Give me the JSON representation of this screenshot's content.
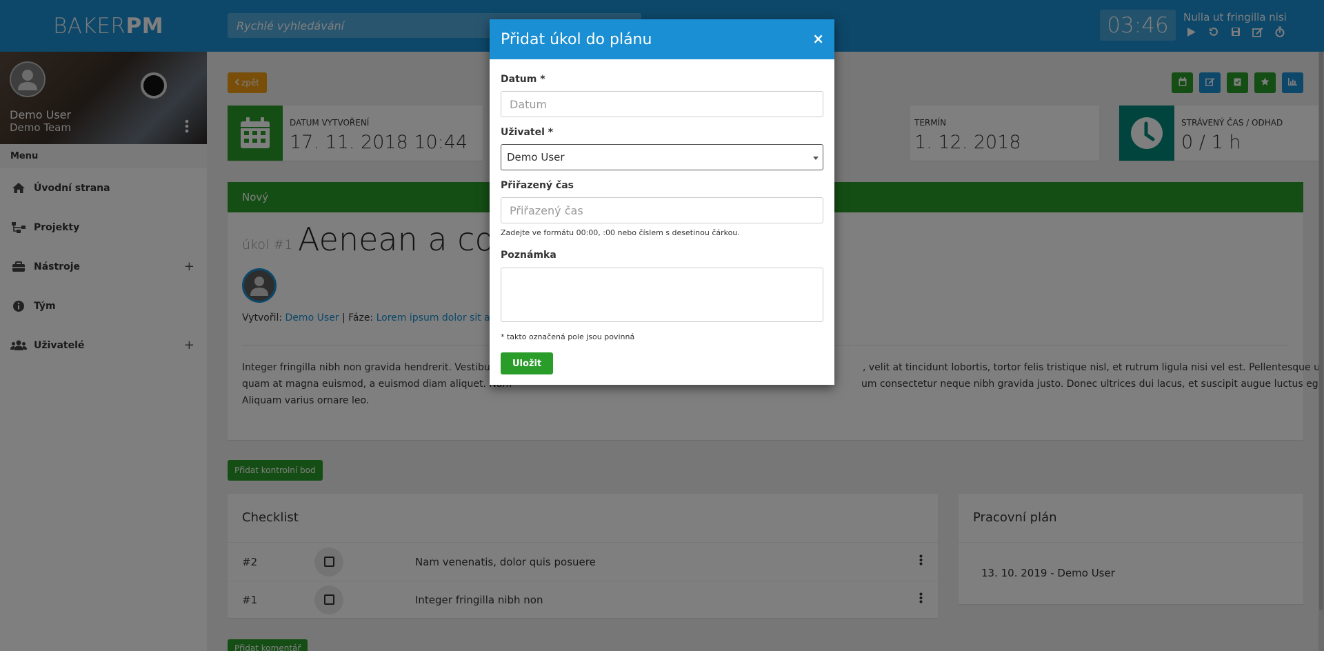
{
  "header": {
    "logo_light": "BAKER",
    "logo_bold": "PM",
    "search_placeholder": "Rychlé vyhledávání",
    "timer": "03:46",
    "timer_task": "Nulla ut fringilla nisi"
  },
  "sidebar": {
    "user_name": "Demo User",
    "user_team": "Demo Team",
    "menu_header": "Menu",
    "items": [
      {
        "label": "Úvodní strana",
        "icon": "home-icon"
      },
      {
        "label": "Projekty",
        "icon": "sitemap-icon"
      },
      {
        "label": "Nástroje",
        "icon": "toolbox-icon",
        "plus": "+"
      },
      {
        "label": "Tým",
        "icon": "info-icon"
      },
      {
        "label": "Uživatelé",
        "icon": "users-icon",
        "plus": "+"
      }
    ]
  },
  "main": {
    "back_label": "zpět",
    "info": {
      "created_label": "Datum vytvoření",
      "created_value": "17. 11. 2018 10:44",
      "deadline_label": "Termín",
      "deadline_value": "1. 12. 2018",
      "time_label": "Strávený čas / odhad",
      "time_value": "0 / 1 h"
    },
    "status": "Nový",
    "task_number": "úkol #1",
    "task_title": "Aenean a conv",
    "meta": {
      "created_by_label": "Vytvořil:",
      "created_by": "Demo User",
      "separator": "|",
      "phase_label": "Fáze:",
      "phase": "Lorem ipsum dolor sit ame"
    },
    "description_left": "Integer fringilla nibh non gravida hendrerit. Vestibulum",
    "description_right": ", velit at tincidunt lobortis, tortor felis tristique nisl, et rutrum ligula nisi vel est. Pellentesque ultrices",
    "description_line2_left": "quam at magna euismod, a euismod diam aliquet. Nam",
    "description_line2_right": "um consectetur neque nibh gravida justo. Donec ultrices dui lacus, et suscipit augue luctus eget.",
    "description_line3": "Aliquam varius ornare leo.",
    "add_checkpoint_label": "Přidat kontrolní bod",
    "checklist_title": "Checklist",
    "checklist": [
      {
        "num": "#2",
        "text": "Nam venenatis, dolor quis posuere"
      },
      {
        "num": "#1",
        "text": "Integer fringilla nibh non"
      }
    ],
    "plan_title": "Pracovní plán",
    "plan_entry": "13. 10. 2019 - Demo User",
    "add_comment_label": "Přidat komentář"
  },
  "modal": {
    "title": "Přidat úkol do plánu",
    "close": "×",
    "date_label": "Datum *",
    "date_placeholder": "Datum",
    "user_label": "Uživatel *",
    "user_value": "Demo User",
    "time_label": "Přiřazený čas",
    "time_placeholder": "Přiřazený čas",
    "time_help": "Zadejte ve formátu 00:00, :00 nebo číslem s desetinou čárkou.",
    "note_label": "Poznámka",
    "required_note": "* takto označená pole jsou povinná",
    "save_label": "Uložit"
  },
  "colors": {
    "primary": "#1a8fd3",
    "success": "#2a9c2a",
    "warning": "#f39c12",
    "teal": "#00897b"
  }
}
